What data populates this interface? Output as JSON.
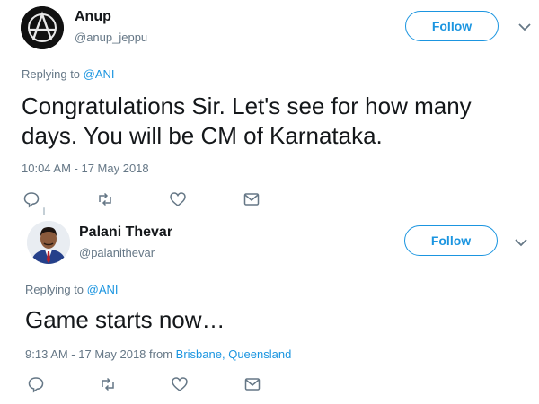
{
  "tweets": [
    {
      "display_name": "Anup",
      "handle": "@anup_jeppu",
      "follow_label": "Follow",
      "reply_prefix": "Replying to",
      "reply_to": "@ANI",
      "text_line1": "Congratulations Sir. Let's see for how many",
      "text_line2": "days. You will be CM of Karnataka.",
      "timestamp": "10:04 AM - 17 May 2018"
    },
    {
      "display_name": "Palani Thevar",
      "handle": "@palanithevar",
      "follow_label": "Follow",
      "reply_prefix": "Replying to",
      "reply_to": "@ANI",
      "text_line1": "Game starts now…",
      "timestamp": "9:13 AM - 17 May 2018 from",
      "location_city": "Brisbane",
      "location_sep": ",",
      "location_region": "Queensland"
    }
  ],
  "colors": {
    "accent": "#1b95e0",
    "text": "#14171a",
    "muted": "#657786"
  },
  "icons": [
    "anarchy-logo-avatar",
    "person-avatar",
    "chevron-down-icon",
    "reply-icon",
    "retweet-icon",
    "like-icon",
    "message-icon"
  ]
}
